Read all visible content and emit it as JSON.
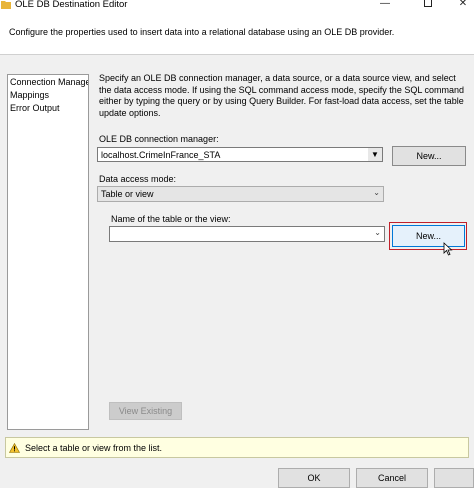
{
  "window": {
    "title": "OLE DB Destination Editor",
    "minimize_glyph": "—",
    "close_glyph": "✕"
  },
  "header": {
    "description": "Configure the properties used to insert data into a relational database using an OLE DB provider."
  },
  "nav": {
    "items": [
      {
        "label": "Connection Manager"
      },
      {
        "label": "Mappings"
      },
      {
        "label": "Error Output"
      }
    ]
  },
  "main": {
    "description": "Specify an OLE DB connection manager, a data source, or a data source view, and select the data access mode. If using the SQL command access mode, specify the SQL command either by typing the query or by using Query Builder. For fast-load data access, set the table update options.",
    "connection_label": "OLE DB connection manager:",
    "connection_value": "localhost.CrimeInFrance_STA",
    "connection_new_label": "New...",
    "access_mode_label": "Data access mode:",
    "access_mode_value": "Table or view",
    "table_label": "Name of the table or the view:",
    "table_value": "",
    "table_new_label": "New...",
    "view_existing_label": "View Existing"
  },
  "status": {
    "text": "Select a table or view from the list."
  },
  "footer": {
    "ok_label": "OK",
    "cancel_label": "Cancel"
  },
  "icons": {
    "app": "folder-icon",
    "warning": "warning-icon",
    "dropdown": "chevron-down-icon",
    "cursor": "mouse-cursor-icon"
  },
  "colors": {
    "highlight_border": "#c0202a",
    "hover_button": "#e5f1fb",
    "status_bg": "#ffffe1"
  }
}
